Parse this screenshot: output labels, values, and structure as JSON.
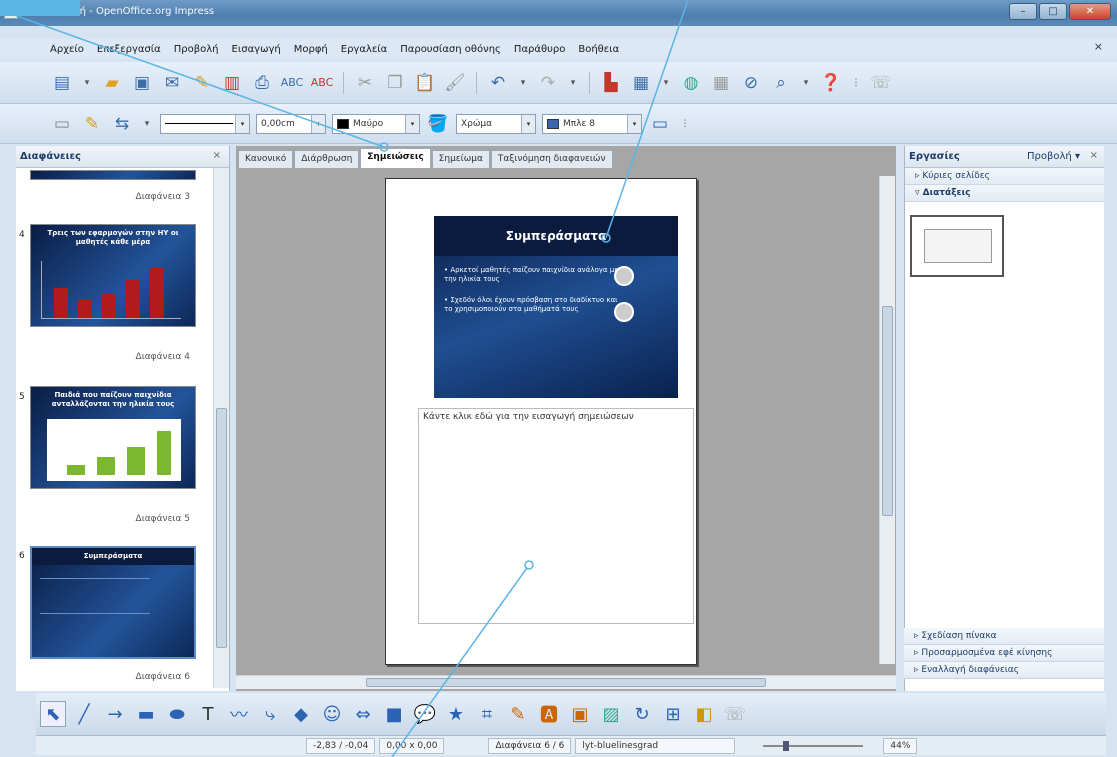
{
  "window": {
    "title": "Προσαρμογή - OpenOffice.org Impress",
    "minimize": "–",
    "maximize": "□",
    "close": "✕"
  },
  "menu": [
    "Αρχείο",
    "Επεξεργασία",
    "Προβολή",
    "Εισαγωγή",
    "Μορφή",
    "Εργαλεία",
    "Παρουσίαση οθόνης",
    "Παράθυρο",
    "Βοήθεια"
  ],
  "menu_close": "×",
  "toolbar2": {
    "line_width": "0,00cm",
    "line_color": "Μαύρο",
    "area_style": "Χρώμα",
    "area_color": "Μπλε 8"
  },
  "slides_panel": {
    "title": "Διαφάνειες",
    "close": "×",
    "items": [
      {
        "label": "Διαφάνεια 3"
      },
      {
        "num": "4",
        "title": "Τρεις των εφαρμογών στην ΗΥ οι μαθητές κάθε μέρα",
        "label": "Διαφάνεια 4"
      },
      {
        "num": "5",
        "title": "Παιδιά που παίζουν παιχνίδια ανταλλάζονται την ηλικία τους",
        "label": "Διαφάνεια 5"
      },
      {
        "num": "6",
        "title": "Συμπεράσματα",
        "label": "Διαφάνεια 6"
      }
    ]
  },
  "tabs": [
    "Κανονικό",
    "Διάρθρωση",
    "Σημειώσεις",
    "Σημείωμα",
    "Ταξινόμηση διαφανειών"
  ],
  "slide": {
    "title": "Συμπεράσματα",
    "bullets": [
      "Αρκετοί μαθητές παίζουν παιχνίδια ανάλογα με την ηλικία τους",
      "Σχεδόν όλοι έχουν πρόσβαση στο διαδίκτυο και το χρησιμοποιούν στα μαθήματά τους"
    ]
  },
  "notes_placeholder": "Κάντε κλικ εδώ για την εισαγωγή σημειώσεων",
  "task_panel": {
    "title": "Εργασίες",
    "view": "Προβολή",
    "view_arrow": "▾",
    "close": "×",
    "sections_top": [
      "Κύριες σελίδες",
      "Διατάξεις"
    ],
    "sections_bottom": [
      "Σχεδίαση πίνακα",
      "Προσαρμοσμένα εφέ κίνησης",
      "Εναλλαγή διαφάνειας"
    ]
  },
  "status": {
    "position": "-2,83 / -0,04",
    "size": "0,00 x 0,00",
    "slide": "Διαφάνεια 6 / 6",
    "master": "lyt-bluelinesgrad",
    "zoom": "44%"
  },
  "icons": {
    "colors": {
      "accent": "#5bb3e6",
      "slide_bg": "#0b1b3e",
      "bar_red": "#b21b1b",
      "bar_green": "#7cb82f"
    }
  }
}
